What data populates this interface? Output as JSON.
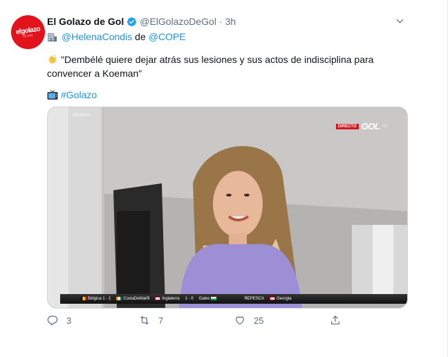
{
  "author": {
    "display_name": "El Golazo de Gol",
    "handle": "@ElGolazoDeGol",
    "separator": "·",
    "time": "3h",
    "avatar_text": "elgolazo",
    "avatar_subtext": "DE GOL"
  },
  "mention_line": {
    "mention": "@HelenaCondis",
    "joiner": "de",
    "org": "@COPE"
  },
  "body": {
    "quote": "\"Dembélé quiere dejar atrás sus lesiones y sus actos de indisciplina para convencer a Koeman\""
  },
  "hashtag": "#Golazo",
  "media": {
    "watermark": "#Golazo",
    "live_tag": "DIRECTO",
    "brand": "GOL",
    "hd": "HD",
    "ticker_items": [
      "Bélgica 1 - 1",
      "CostaDeMarfil",
      "Inglaterra",
      "1 - 0",
      "Gales",
      "REPESCA",
      "Georgia"
    ]
  },
  "actions": {
    "reply_count": "3",
    "retweet_count": "7",
    "like_count": "25"
  },
  "colors": {
    "link": "#1b95e0",
    "muted": "#5b7083",
    "brand_red": "#e2131a"
  }
}
